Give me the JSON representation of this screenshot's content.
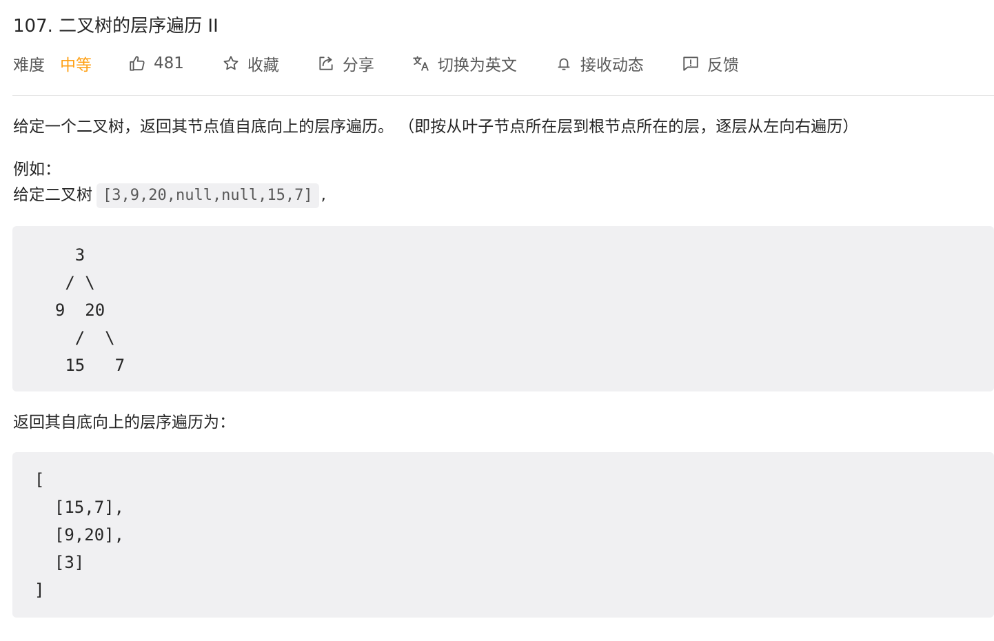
{
  "problem": {
    "title": "107. 二叉树的层序遍历 II"
  },
  "toolbar": {
    "difficulty_label": "难度",
    "difficulty_value": "中等",
    "difficulty_color": "#ffa116",
    "likes": "481",
    "like_icon": "thumbs-up-icon",
    "favorite_label": "收藏",
    "favorite_icon": "star-icon",
    "share_label": "分享",
    "share_icon": "share-icon",
    "translate_label": "切换为英文",
    "translate_icon": "translate-icon",
    "subscribe_label": "接收动态",
    "subscribe_icon": "bell-icon",
    "feedback_label": "反馈",
    "feedback_icon": "feedback-icon"
  },
  "content": {
    "description": "给定一个二叉树，返回其节点值自底向上的层序遍历。 （即按从叶子节点所在层到根节点所在的层，逐层从左向右遍历）",
    "example_label": "例如：",
    "given_prefix": "给定二叉树",
    "given_code": "[3,9,20,null,null,15,7]",
    "given_suffix": ",",
    "tree_diagram": "    3\n   / \\\n  9  20\n    /  \\\n   15   7",
    "return_label": "返回其自底向上的层序遍历为：",
    "result_code": "[\n  [15,7],\n  [9,20],\n  [3]\n]"
  },
  "colors": {
    "accent_orange": "#ffa116",
    "code_background": "#f0f0f2",
    "text_primary": "#262626",
    "text_secondary": "#595959"
  }
}
